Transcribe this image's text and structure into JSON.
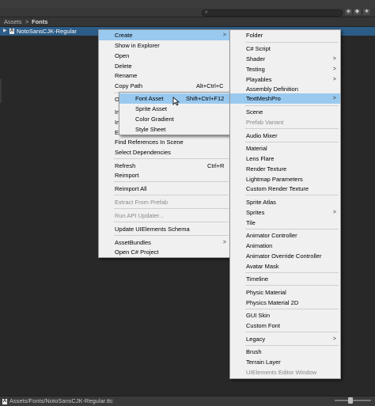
{
  "breadcrumb": {
    "root": "Assets",
    "sep": ">",
    "current": "Fonts"
  },
  "asset": {
    "name": "NotoSansCJK-Regular",
    "icon": "font-file-icon"
  },
  "status_path": "Assets/Fonts/NotoSansCJK-Regular.ttc",
  "menu_main": {
    "items": [
      {
        "label": "Create",
        "shortcut": "",
        "arrow": ">"
      },
      {
        "label": "Show in Explorer"
      },
      {
        "label": "Open"
      },
      {
        "label": "Delete"
      },
      {
        "label": "Rename"
      },
      {
        "label": "Copy Path",
        "shortcut": "Alt+Ctrl+C"
      },
      {
        "label": "Op"
      },
      {
        "label": "Im"
      },
      {
        "label": "Im"
      },
      {
        "label": "Ex"
      },
      {
        "label": "Find References In Scene"
      },
      {
        "label": "Select Dependencies"
      },
      {
        "label": "Refresh",
        "shortcut": "Ctrl+R"
      },
      {
        "label": "Reimport"
      },
      {
        "label": "Reimport All"
      },
      {
        "label": "Extract From Prefab"
      },
      {
        "label": "Run API Updater..."
      },
      {
        "label": "Update UIElements Schema"
      },
      {
        "label": "AssetBundles",
        "arrow": ">"
      },
      {
        "label": "Open C# Project"
      }
    ]
  },
  "menu_tmp": {
    "items": [
      {
        "label": "Font Asset",
        "shortcut": "Shift+Ctrl+F12"
      },
      {
        "label": "Sprite Asset"
      },
      {
        "label": "Color Gradient"
      },
      {
        "label": "Style Sheet"
      }
    ]
  },
  "menu_create": {
    "items": [
      {
        "label": "Folder"
      },
      {
        "label": "C# Script"
      },
      {
        "label": "Shader",
        "arrow": ">"
      },
      {
        "label": "Testing",
        "arrow": ">"
      },
      {
        "label": "Playables",
        "arrow": ">"
      },
      {
        "label": "Assembly Definition"
      },
      {
        "label": "TextMeshPro",
        "arrow": ">"
      },
      {
        "label": "Scene"
      },
      {
        "label": "Prefab Variant"
      },
      {
        "label": "Audio Mixer"
      },
      {
        "label": "Material"
      },
      {
        "label": "Lens Flare"
      },
      {
        "label": "Render Texture"
      },
      {
        "label": "Lightmap Parameters"
      },
      {
        "label": "Custom Render Texture"
      },
      {
        "label": "Sprite Atlas"
      },
      {
        "label": "Sprites",
        "arrow": ">"
      },
      {
        "label": "Tile"
      },
      {
        "label": "Animator Controller"
      },
      {
        "label": "Animation"
      },
      {
        "label": "Animator Override Controller"
      },
      {
        "label": "Avatar Mask"
      },
      {
        "label": "Timeline"
      },
      {
        "label": "Physic Material"
      },
      {
        "label": "Physics Material 2D"
      },
      {
        "label": "GUI Skin"
      },
      {
        "label": "Custom Font"
      },
      {
        "label": "Legacy",
        "arrow": ">"
      },
      {
        "label": "Brush"
      },
      {
        "label": "Terrain Layer"
      },
      {
        "label": "UIElements Editor Window"
      }
    ]
  },
  "colors": {
    "highlight": "#99c9ef",
    "selection": "#2c5d87",
    "menu_bg": "#f0f0f0",
    "disabled": "#8a8a8a"
  }
}
